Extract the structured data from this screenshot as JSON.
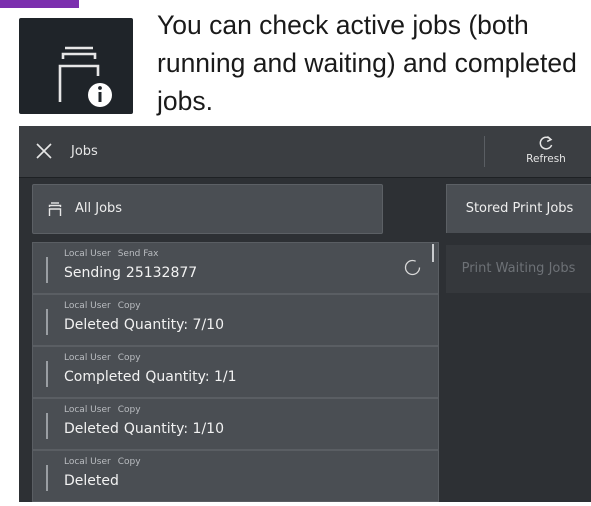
{
  "intro": {
    "text": "You can check active jobs (both running and waiting) and completed jobs."
  },
  "titlebar": {
    "title": "Jobs",
    "refresh_label": "Refresh"
  },
  "all_jobs": {
    "label": "All Jobs"
  },
  "side_buttons": {
    "stored": "Stored Print Jobs",
    "waiting": "Print Waiting Jobs"
  },
  "jobs": [
    {
      "user": "Local User",
      "type": "Send Fax",
      "status": "Sending",
      "detail": "25132877",
      "in_progress": true
    },
    {
      "user": "Local User",
      "type": "Copy",
      "status": "Deleted",
      "detail": "Quantity: 7/10",
      "in_progress": false
    },
    {
      "user": "Local User",
      "type": "Copy",
      "status": "Completed",
      "detail": "Quantity: 1/1",
      "in_progress": false
    },
    {
      "user": "Local User",
      "type": "Copy",
      "status": "Deleted",
      "detail": "Quantity: 1/10",
      "in_progress": false
    },
    {
      "user": "Local User",
      "type": "Copy",
      "status": "Deleted",
      "detail": "",
      "in_progress": false
    }
  ],
  "colors": {
    "accent": "#7b2fae",
    "panel": "#2d3034",
    "button": "#4a4e53"
  },
  "icons": {
    "hero": "job-status-info-icon",
    "close": "close-icon",
    "refresh": "refresh-icon",
    "all_jobs": "job-stack-icon",
    "spinner": "progress-spinner-icon"
  }
}
